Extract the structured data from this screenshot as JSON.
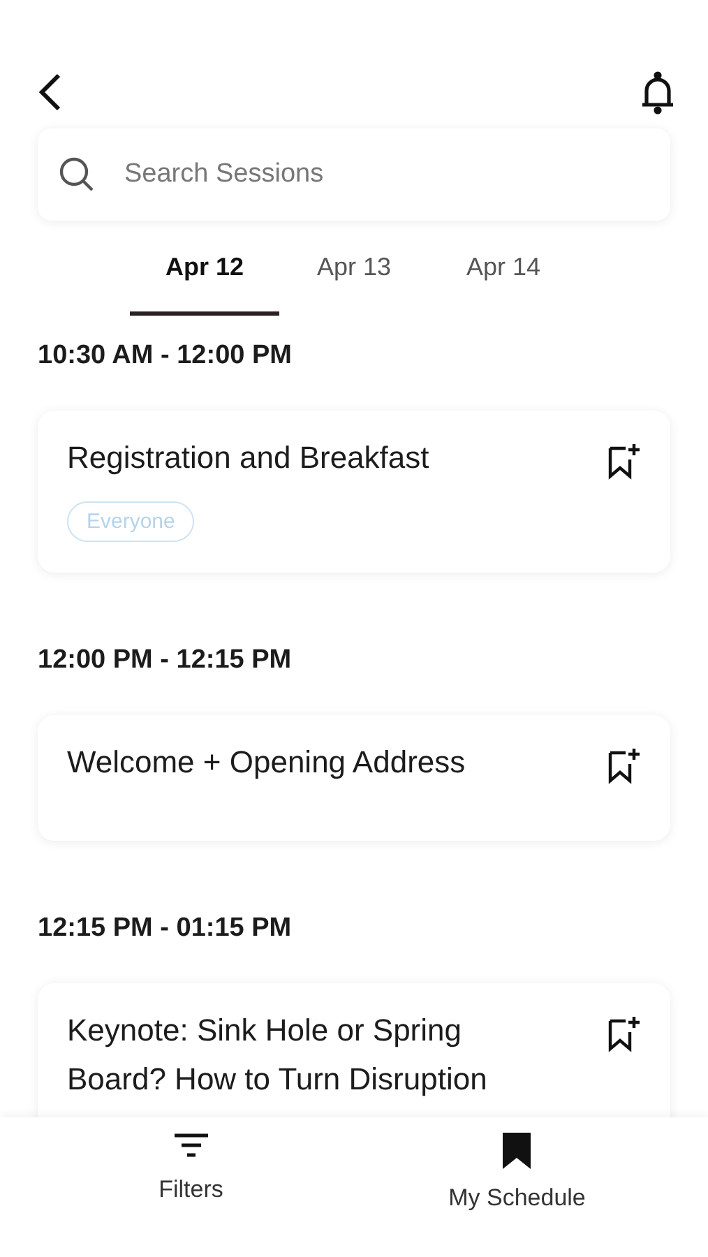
{
  "search": {
    "placeholder": "Search Sessions"
  },
  "tabs": [
    {
      "label": "Apr 12",
      "selected": true
    },
    {
      "label": "Apr 13",
      "selected": false
    },
    {
      "label": "Apr 14",
      "selected": false
    }
  ],
  "slots": [
    {
      "time": "10:30 AM -  12:00 PM",
      "sessions": [
        {
          "title": "Registration and Breakfast",
          "tags": [
            "Everyone"
          ],
          "bookmarked": false
        }
      ]
    },
    {
      "time": "12:00 PM -  12:15 PM",
      "sessions": [
        {
          "title": "Welcome + Opening Address",
          "bookmarked": false
        }
      ]
    },
    {
      "time": "12:15 PM -  01:15 PM",
      "sessions": [
        {
          "title": "Keynote: Sink Hole or Spring Board? How to Turn Disruption",
          "bookmarked": false
        }
      ]
    }
  ],
  "bottom_nav": [
    {
      "label": "Filters",
      "kind": "filter"
    },
    {
      "label": "My Schedule",
      "kind": "bookmark"
    }
  ]
}
